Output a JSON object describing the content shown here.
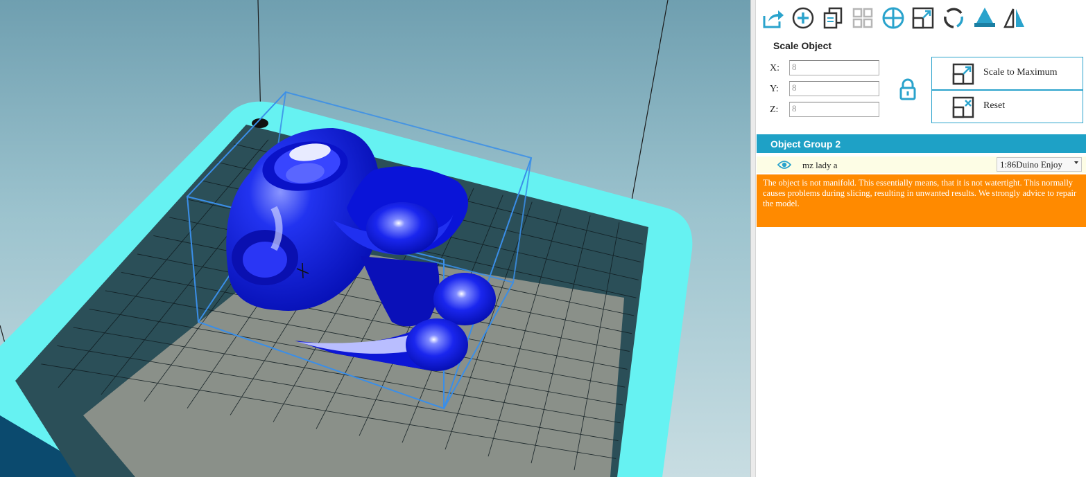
{
  "toolbar": {
    "buttons": [
      {
        "name": "export-icon"
      },
      {
        "name": "add-object-icon"
      },
      {
        "name": "copy-object-icon"
      },
      {
        "name": "arrange-grid-icon"
      },
      {
        "name": "move-object-icon"
      },
      {
        "name": "scale-object-icon"
      },
      {
        "name": "rotate-object-icon"
      },
      {
        "name": "cut-object-icon"
      },
      {
        "name": "mirror-object-icon"
      }
    ]
  },
  "scale": {
    "title": "Scale Object",
    "x_label": "X:",
    "y_label": "Y:",
    "z_label": "Z:",
    "x_value": "8",
    "y_value": "8",
    "z_value": "8",
    "scale_max_label": "Scale to Maximum",
    "reset_label": "Reset"
  },
  "objects": {
    "group_title": "Object Group 2",
    "items": [
      {
        "name": "mz lady a",
        "profile": "1:86Duino Enjoy"
      }
    ],
    "warning": "The object is not manifold. This essentially means, that it is not watertight. This normally causes problems during slicing, resulting in unwanted results. We strongly advice to repair the model."
  },
  "colors": {
    "accent": "#1ea1c6",
    "warning_bg": "#ff8a00",
    "bed_border": "#66f2f2",
    "model": "#0a14e6",
    "bounding_box": "#3a8ee8"
  }
}
